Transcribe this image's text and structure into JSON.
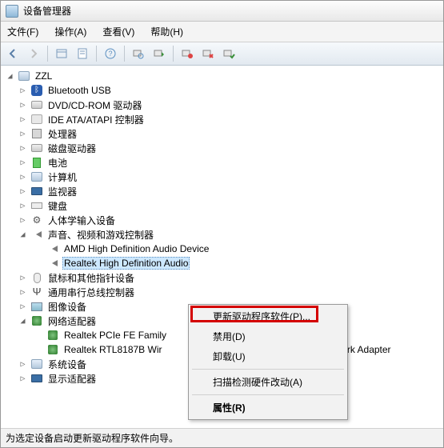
{
  "window": {
    "title": "设备管理器"
  },
  "menu": {
    "file": "文件(F)",
    "action": "操作(A)",
    "view": "查看(V)",
    "help": "帮助(H)"
  },
  "root": {
    "name": "ZZL"
  },
  "categories": [
    {
      "key": "bluetooth",
      "label": "Bluetooth USB",
      "expander": "▷"
    },
    {
      "key": "dvd",
      "label": "DVD/CD-ROM 驱动器",
      "expander": "▷"
    },
    {
      "key": "ide",
      "label": "IDE ATA/ATAPI 控制器",
      "expander": "▷"
    },
    {
      "key": "cpu",
      "label": "处理器",
      "expander": "▷"
    },
    {
      "key": "disk",
      "label": "磁盘驱动器",
      "expander": "▷"
    },
    {
      "key": "battery",
      "label": "电池",
      "expander": "▷"
    },
    {
      "key": "computer",
      "label": "计算机",
      "expander": "▷"
    },
    {
      "key": "monitor",
      "label": "监视器",
      "expander": "▷"
    },
    {
      "key": "keyboard",
      "label": "键盘",
      "expander": "▷"
    },
    {
      "key": "hid",
      "label": "人体学输入设备",
      "expander": "▷"
    }
  ],
  "sound": {
    "label": "声音、视频和游戏控制器",
    "expander": "◢",
    "children": [
      {
        "label": "AMD High Definition Audio Device"
      },
      {
        "label": "Realtek High Definition Audio",
        "selected": true
      }
    ]
  },
  "after_sound": [
    {
      "key": "mouse",
      "label": "鼠标和其他指针设备",
      "expander": "▷"
    },
    {
      "key": "usb",
      "label": "通用串行总线控制器",
      "expander": "▷"
    },
    {
      "key": "image",
      "label": "图像设备",
      "expander": "▷"
    }
  ],
  "network": {
    "label": "网络适配器",
    "expander": "◢",
    "children": [
      {
        "label": "Realtek PCIe FE Family"
      },
      {
        "label": "Realtek RTL8187B Wir",
        "suffix": "etwork Adapter"
      }
    ]
  },
  "tail": [
    {
      "key": "system",
      "label": "系统设备",
      "expander": "▷"
    },
    {
      "key": "display",
      "label": "显示适配器",
      "expander": "▷"
    }
  ],
  "context_menu": {
    "update": "更新驱动程序软件(P)...",
    "disable": "禁用(D)",
    "uninstall": "卸载(U)",
    "scan": "扫描检测硬件改动(A)",
    "properties": "属性(R)"
  },
  "status": "为选定设备启动更新驱动程序软件向导。"
}
